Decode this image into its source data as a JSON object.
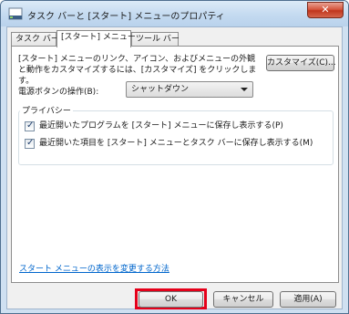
{
  "window": {
    "title": "タスク バーと [スタート] メニューのプロパティ",
    "title_icon": "taskbar-properties-icon",
    "close_label": "✕"
  },
  "tabs": [
    {
      "label": "タスク バー",
      "active": false
    },
    {
      "label": "[スタート] メニュー",
      "active": true
    },
    {
      "label": "ツール バー",
      "active": false
    }
  ],
  "start_menu": {
    "description": "[スタート] メニューのリンク、アイコン、およびメニューの外観と動作をカスタマイズするには、[カスタマイズ] をクリックします。",
    "customize_label": "カスタマイズ(C)...",
    "power_button_label": "電源ボタンの操作(B):",
    "power_button_value": "シャットダウン",
    "privacy": {
      "legend": "プライバシー",
      "options": [
        {
          "label": "最近開いたプログラムを [スタート] メニューに保存し表示する(P)",
          "checked": true
        },
        {
          "label": "最近開いた項目を [スタート] メニューとタスク バーに保存し表示する(M)",
          "checked": true
        }
      ]
    },
    "help_link": "スタート メニューの表示を変更する方法"
  },
  "footer": {
    "ok_label": "OK",
    "cancel_label": "キャンセル",
    "apply_label": "適用(A)"
  },
  "colors": {
    "highlight": "#e5001a",
    "link": "#0066cc",
    "title_bar": "#c4daf0"
  }
}
